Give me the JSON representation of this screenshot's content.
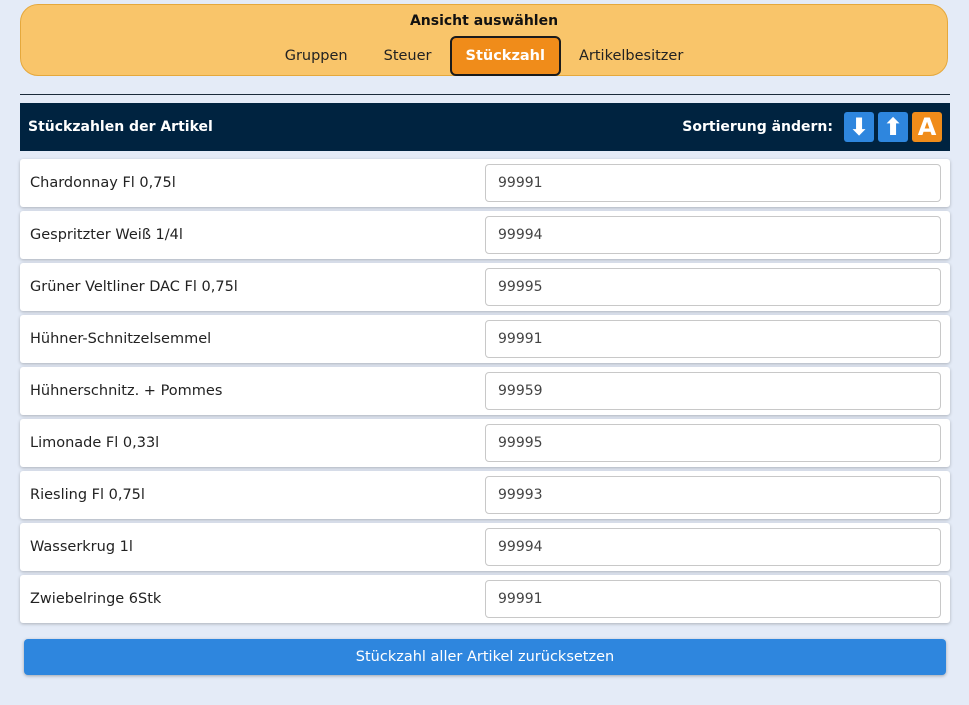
{
  "view_select": {
    "title": "Ansicht auswählen",
    "tabs": [
      {
        "label": "Gruppen",
        "active": false
      },
      {
        "label": "Steuer",
        "active": false
      },
      {
        "label": "Stückzahl",
        "active": true
      },
      {
        "label": "Artikelbesitzer",
        "active": false
      }
    ]
  },
  "header": {
    "title": "Stückzahlen der Artikel",
    "sort_label": "Sortierung ändern:",
    "sort_buttons": [
      {
        "icon": "arrow-down-icon",
        "glyph": "⬇"
      },
      {
        "icon": "arrow-up-icon",
        "glyph": "⬆"
      },
      {
        "icon": "alphabetical-sort-icon",
        "glyph": "A"
      }
    ]
  },
  "items": [
    {
      "name": "Chardonnay Fl 0,75l",
      "count": "99991"
    },
    {
      "name": "Gespritzter Weiß 1/4l",
      "count": "99994"
    },
    {
      "name": "Grüner Veltliner DAC Fl 0,75l",
      "count": "99995"
    },
    {
      "name": "Hühner-Schnitzelsemmel",
      "count": "99991"
    },
    {
      "name": "Hühnerschnitz. + Pommes",
      "count": "99959"
    },
    {
      "name": "Limonade Fl 0,33l",
      "count": "99995"
    },
    {
      "name": "Riesling Fl 0,75l",
      "count": "99993"
    },
    {
      "name": "Wasserkrug 1l",
      "count": "99994"
    },
    {
      "name": "Zwiebelringe 6Stk",
      "count": "99991"
    }
  ],
  "reset_button": {
    "label": "Stückzahl aller Artikel zurücksetzen"
  },
  "colors": {
    "accent_orange": "#f08c1a",
    "panel_yellow": "#f9c56a",
    "header_navy": "#002340",
    "button_blue": "#2e86de"
  }
}
